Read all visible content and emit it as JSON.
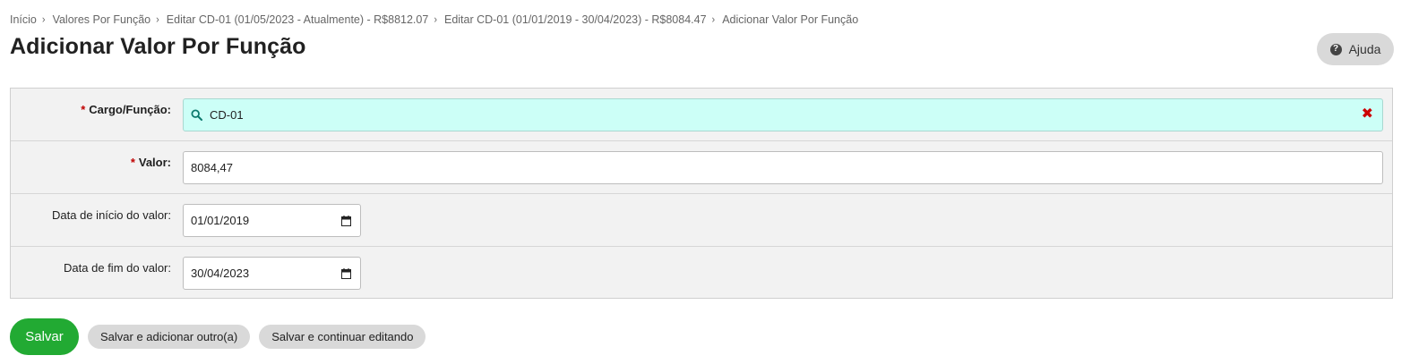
{
  "breadcrumb": [
    {
      "label": "Início"
    },
    {
      "label": "Valores Por Função"
    },
    {
      "label": "Editar CD-01 (01/05/2023 - Atualmente) - R$8812.07"
    },
    {
      "label": "Editar CD-01 (01/01/2019 - 30/04/2023) - R$8084.47"
    },
    {
      "label": "Adicionar Valor Por Função"
    }
  ],
  "page": {
    "title": "Adicionar Valor Por Função",
    "help_label": "Ajuda",
    "help_icon": "question-circle-icon"
  },
  "form": {
    "cargo": {
      "label": "Cargo/Função:",
      "required": true,
      "value": "CD-01",
      "icon": "search-icon",
      "clear_icon": "close-icon"
    },
    "valor": {
      "label": "Valor:",
      "required": true,
      "value": "8084,47"
    },
    "data_inicio": {
      "label": "Data de início do valor:",
      "required": false,
      "value": "01/01/2019",
      "icon": "calendar-icon"
    },
    "data_fim": {
      "label": "Data de fim do valor:",
      "required": false,
      "value": "30/04/2023",
      "icon": "calendar-icon"
    }
  },
  "actions": {
    "save": "Salvar",
    "save_add": "Salvar e adicionar outro(a)",
    "save_continue": "Salvar e continuar editando"
  },
  "colors": {
    "primary": "#22aa33",
    "search_field_bg": "#ccfff7",
    "required_star": "#c00000",
    "clear_icon": "#cc0000"
  }
}
